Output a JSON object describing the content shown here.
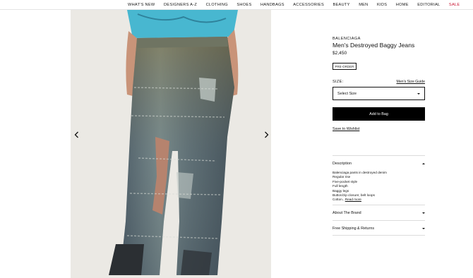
{
  "nav": {
    "items": [
      "WHAT'S NEW",
      "DESIGNERS A-Z",
      "CLOTHING",
      "SHOES",
      "HANDBAGS",
      "ACCESSORIES",
      "BEAUTY",
      "MEN",
      "KIDS",
      "HOME",
      "EDITORIAL"
    ],
    "sale": "SALE",
    "sale_color": "#c8102e"
  },
  "gallery": {
    "prev_icon": "chevron-left-icon",
    "next_icon": "chevron-right-icon",
    "background": "#ebe9e4"
  },
  "product": {
    "brand": "BALENCIAGA",
    "title": "Men's Destroyed Baggy Jeans",
    "price": "$2,450",
    "badge": "PRE-ORDER",
    "size_label": "SIZE:",
    "size_guide": "Men's Size Guide",
    "size_select": "Select Size",
    "add_to_bag": "Add to Bag",
    "wishlist": "Save to Wishlist"
  },
  "accordion": {
    "description": {
      "title": "Description",
      "lines": [
        "Balenciaga pants in destroyed denim",
        "Regular rise",
        "Five-pocket style",
        "Full length",
        "Baggy legs",
        "Button/zip closure; belt loops"
      ],
      "last_line": "Cotton...",
      "read_more": "Read more"
    },
    "about": {
      "title": "About The Brand"
    },
    "shipping": {
      "title": "Free Shipping & Returns"
    }
  }
}
